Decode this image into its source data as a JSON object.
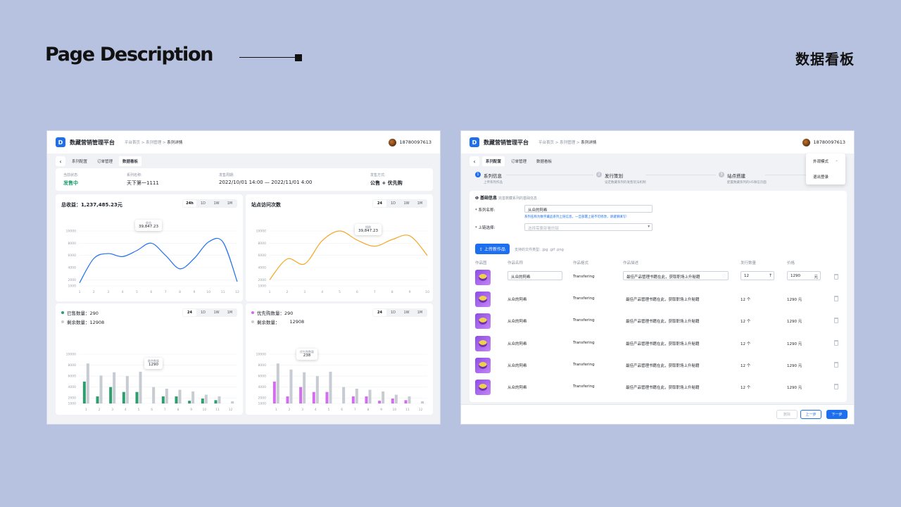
{
  "header": {
    "title": "Page Description",
    "right_title": "数据看板"
  },
  "left": {
    "app_name": "数藏营销管理平台",
    "breadcrumb": [
      "平台首页",
      "系列管理",
      "系列详情"
    ],
    "user": "18780097613",
    "tabs": [
      "系列配置",
      "订单管理",
      "数据看板"
    ],
    "info": [
      {
        "label": "当前状态:",
        "value": "发售中",
        "color": "#1aa06d"
      },
      {
        "label": "系列名称:",
        "value": "天下第一1111"
      },
      {
        "label": "发售周期:",
        "value": "2022/10/01  14:00 — 2022/11/01  4:00"
      },
      {
        "label": "发售方式:",
        "value": "公售 + 优先购"
      }
    ],
    "revenue": {
      "title": "总收益：1,237,485.23元",
      "ranges": [
        "24h",
        "1D",
        "1W",
        "1M"
      ],
      "tip_label": "收益",
      "tip_value": "39,847.23"
    },
    "visits": {
      "title": "站点访问次数",
      "ranges": [
        "24",
        "1D",
        "1W",
        "1M"
      ],
      "tip_label": "搜刷",
      "tip_value": "39,847.23"
    },
    "sold": {
      "legend1": "已售数量：290",
      "legend2": "剩余数量：12908",
      "ranges": [
        "24",
        "1D",
        "1W",
        "1M"
      ],
      "tip_label": "剩余数量",
      "tip_value": "1290"
    },
    "priority": {
      "legend1": "优先购数量：290",
      "legend2": "剩余数量：",
      "legend2_value": "12908",
      "ranges": [
        "24",
        "1D",
        "1W",
        "1M"
      ],
      "tip_label": "优先购数量",
      "tip_value": "238"
    }
  },
  "chart_data": [
    {
      "type": "line",
      "title": "总收益：1,237,485.23元",
      "x": [
        1,
        2,
        3,
        4,
        5,
        6,
        7,
        8,
        9,
        10,
        11,
        12
      ],
      "series": [
        {
          "values": [
            1500,
            5500,
            6300,
            5800,
            6800,
            8000,
            6000,
            3800,
            5500,
            8200,
            8200,
            1700
          ]
        }
      ],
      "ylim": [
        1000,
        10000
      ],
      "yticks": [
        1000,
        2000,
        4000,
        6000,
        8000,
        10000
      ]
    },
    {
      "type": "line",
      "title": "站点访问次数",
      "x": [
        1,
        2,
        3,
        4,
        5,
        6,
        7,
        8,
        9,
        10
      ],
      "series": [
        {
          "values": [
            2000,
            5400,
            4600,
            8400,
            10000,
            8500,
            7500,
            8600,
            9200,
            6000
          ]
        }
      ],
      "ylim": [
        1000,
        10000
      ],
      "yticks": [
        1000,
        2000,
        4000,
        6000,
        8000,
        10000
      ]
    },
    {
      "type": "bar",
      "x": [
        1,
        2,
        3,
        4,
        5,
        6,
        7,
        8,
        9,
        10,
        11,
        12
      ],
      "series": [
        {
          "name": "已售数量",
          "values": [
            5000,
            2300,
            4000,
            3100,
            3100,
            900,
            2300,
            2300,
            1500,
            1900,
            1600,
            800
          ]
        },
        {
          "name": "剩余数量",
          "values": [
            8300,
            6100,
            6700,
            6000,
            6800,
            4000,
            3700,
            3500,
            3200,
            2600,
            2300,
            1400
          ]
        }
      ],
      "ylim": [
        1000,
        10000
      ],
      "yticks": [
        1000,
        2000,
        4000,
        6000,
        8000,
        10000
      ]
    },
    {
      "type": "bar",
      "x": [
        1,
        2,
        3,
        4,
        5,
        6,
        7,
        8,
        9,
        10,
        11,
        12
      ],
      "series": [
        {
          "name": "优先购数量",
          "values": [
            5000,
            2300,
            4000,
            3100,
            3100,
            900,
            2300,
            2300,
            1500,
            1900,
            1600,
            800
          ]
        },
        {
          "name": "剩余数量",
          "values": [
            8300,
            7200,
            6700,
            6000,
            6800,
            4000,
            3700,
            3500,
            3200,
            2600,
            2300,
            1400
          ]
        }
      ],
      "ylim": [
        1000,
        10000
      ],
      "yticks": [
        1000,
        2000,
        4000,
        6000,
        8000,
        10000
      ]
    }
  ],
  "right": {
    "app_name": "数藏营销管理平台",
    "breadcrumb": [
      "平台首页",
      "系列管理",
      "系列详情"
    ],
    "user": "18780097613",
    "tabs": [
      "系列配置",
      "订单管理",
      "数据看板"
    ],
    "menu": [
      "外观模式",
      "退出登录"
    ],
    "steps": [
      {
        "num": "1",
        "title": "系列信息",
        "sub": "上传系列作品"
      },
      {
        "num": "2",
        "title": "发行策划",
        "sub": "设定数藏系列的发售玩法机制"
      },
      {
        "num": "3",
        "title": "站点搭建",
        "sub": "配置数藏系列的H5微信页面"
      }
    ],
    "section_title": "基础信息",
    "section_sub": "完善数藏系列的基础信息",
    "name_label": "* 系列名称:",
    "name_value": "从众的阿希",
    "name_hint": "系列名称为数字藏品系列上链信息，一旦部署上链不可修改，请谨慎填写!",
    "chain_label": "* 上链选择:",
    "chain_placeholder": "选择需要部署的链",
    "upload_btn": "上传新作品",
    "upload_hint": "支持的文件类型: .jpg .gif .png",
    "columns": [
      "作品图",
      "作品名称",
      "作品格式",
      "作品描述",
      "发行数量",
      "价格"
    ],
    "rows": [
      {
        "name": "从众的阿希",
        "format": "Transfering",
        "desc": "最佳产品管理书籍在此，获取职场上升秘籍",
        "qty": "12",
        "price": "1290",
        "unit": "元"
      },
      {
        "name": "从众的阿希",
        "format": "Transfering",
        "desc": "最佳产品管理书籍在此，获取职场上升秘籍",
        "qty": "12 个",
        "price": "1290 元"
      },
      {
        "name": "从众的阿希",
        "format": "Transfering",
        "desc": "最佳产品管理书籍在此，获取职场上升秘籍",
        "qty": "12 个",
        "price": "1290 元"
      },
      {
        "name": "从众的阿希",
        "format": "Transfering",
        "desc": "最佳产品管理书籍在此，获取职场上升秘籍",
        "qty": "12 个",
        "price": "1290 元"
      },
      {
        "name": "从众的阿希",
        "format": "Transfering",
        "desc": "最佳产品管理书籍在此，获取职场上升秘籍",
        "qty": "12 个",
        "price": "1290 元"
      },
      {
        "name": "从众的阿希",
        "format": "Transfering",
        "desc": "最佳产品管理书籍在此，获取职场上升秘籍",
        "qty": "12 个",
        "price": "1290 元"
      }
    ],
    "buttons": {
      "delete": "删除",
      "prev": "上一步",
      "next": "下一步"
    }
  }
}
